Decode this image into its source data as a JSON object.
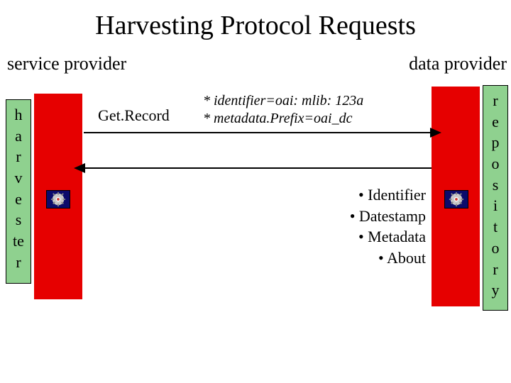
{
  "title": "Harvesting Protocol Requests",
  "labels": {
    "service_provider": "service provider",
    "data_provider": "data provider"
  },
  "left_box": {
    "letters": [
      "h",
      "a",
      "r",
      "v",
      "e",
      "s",
      "te",
      "r"
    ],
    "name": "harvester"
  },
  "right_box": {
    "letters": [
      "r",
      "e",
      "p",
      "o",
      "s",
      "i",
      "t",
      "o",
      "r",
      "y"
    ],
    "name": "repository"
  },
  "request": {
    "verb": "Get.Record",
    "params": [
      "* identifier=oai: mlib: 123a",
      "* metadata.Prefix=oai_dc"
    ]
  },
  "response": {
    "items": [
      "• Identifier",
      "• Datestamp",
      "• Metadata",
      "• About"
    ]
  },
  "icons": {
    "gear": "gear-icon"
  }
}
